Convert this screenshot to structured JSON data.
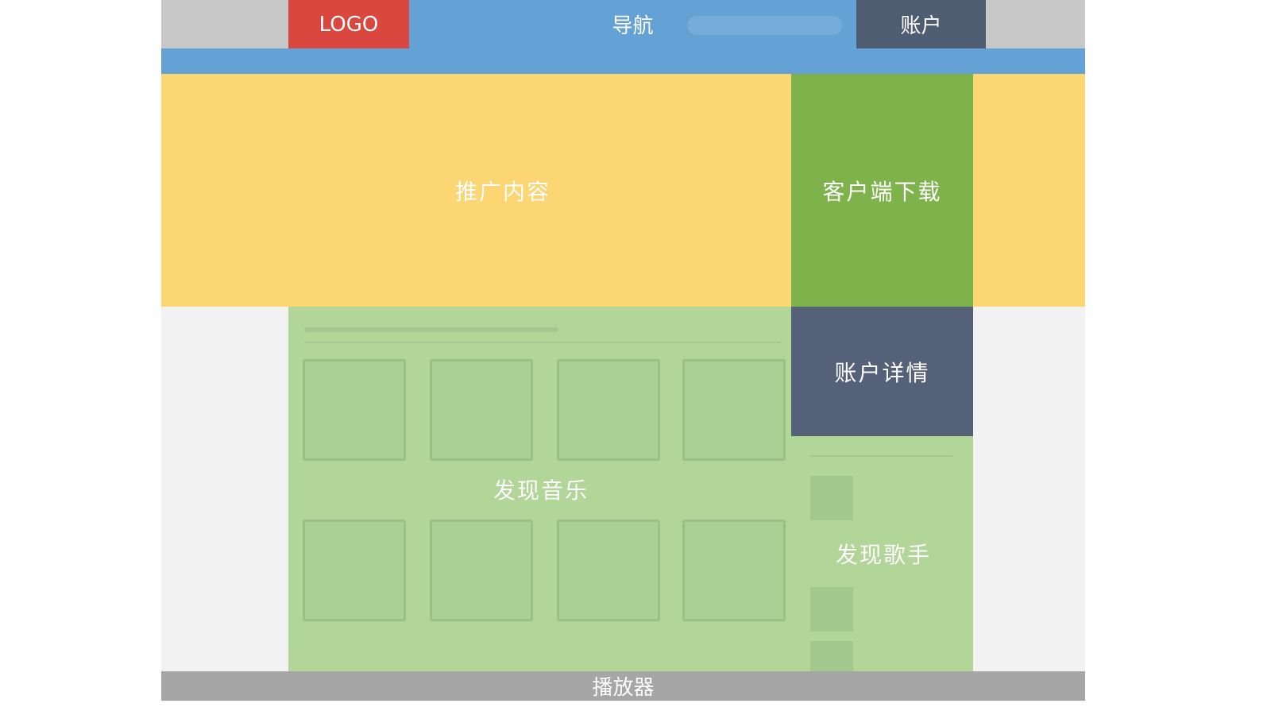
{
  "diagram": {
    "header": {
      "logo_label": "LOGO",
      "nav_label": "导航",
      "account_label": "账户"
    },
    "banner": {
      "promo_label": "推广内容",
      "download_label": "客户端下载"
    },
    "main": {
      "discover_music_label": "发现音乐",
      "account_detail_label": "账户详情",
      "discover_singer_label": "发现歌手"
    },
    "footer": {
      "player_label": "播放器"
    },
    "colors": {
      "header_side": "#c8c8c8",
      "logo": "#d9473e",
      "nav": "#64a1d4",
      "account": "#4f5d73",
      "banner": "#fcd672",
      "download": "#7eb24b",
      "side_bg": "#f2f2f2",
      "discover": "#b1d698",
      "account_detail": "#546178",
      "player": "#a6a6a6"
    }
  }
}
